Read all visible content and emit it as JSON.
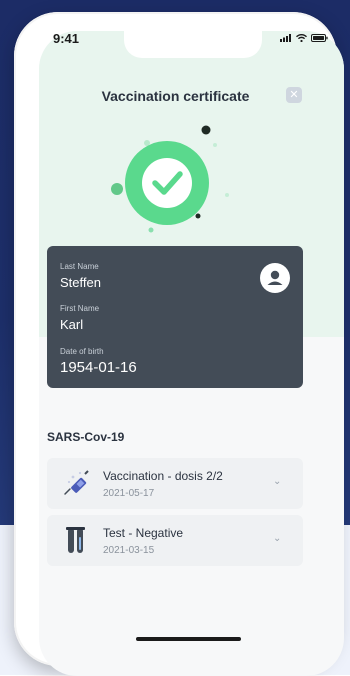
{
  "status_bar": {
    "time": "9:41"
  },
  "header": {
    "title": "Vaccination certificate",
    "close_icon": "close-icon"
  },
  "status": {
    "icon": "check-icon",
    "color": "#5ad98d"
  },
  "person": {
    "last_name_label": "Last Name",
    "last_name": "Steffen",
    "first_name_label": "First Name",
    "first_name": "Karl",
    "dob_label": "Date of birth",
    "dob": "1954-01-16",
    "avatar_icon": "user-icon"
  },
  "records": {
    "section_title": "SARS-Cov-19",
    "items": [
      {
        "title": "Vaccination - dosis 2/2",
        "date": "2021-05-17",
        "icon": "syringe-icon"
      },
      {
        "title": "Test - Negative",
        "date": "2021-03-15",
        "icon": "test-tube-icon"
      }
    ]
  },
  "colors": {
    "accent": "#5ad98d",
    "card": "#434c57",
    "background": "#1c2c66"
  }
}
